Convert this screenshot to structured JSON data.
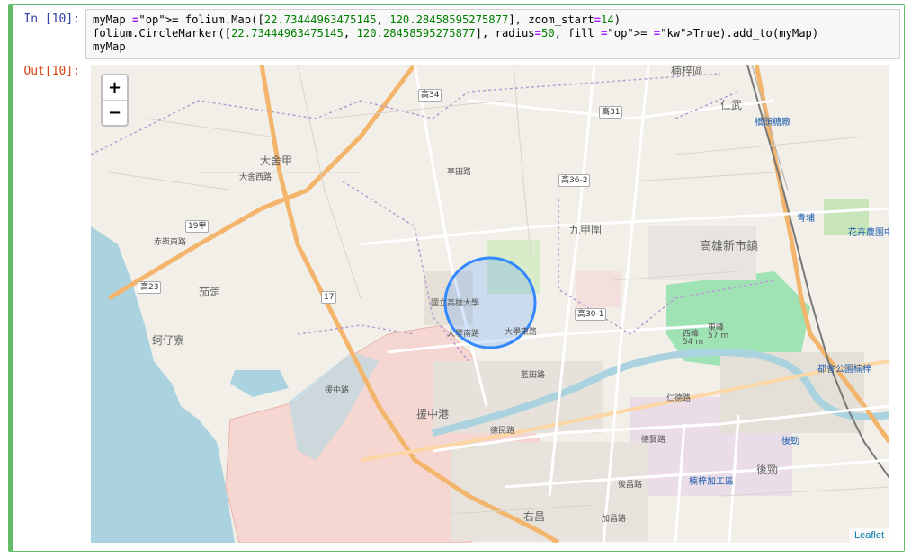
{
  "cell": {
    "in_prompt": "In [10]:",
    "out_prompt": "Out[10]:",
    "code_lines": [
      "myMap = folium.Map([22.73444963475145, 120.28458595275877], zoom_start=14)",
      "folium.CircleMarker([22.73444963475145, 120.28458595275877], radius=50, fill = True).add_to(myMap)",
      "myMap"
    ]
  },
  "map": {
    "zoom_in": "+",
    "zoom_out": "−",
    "attribution": "Leaflet",
    "marker_color": "#3388ff",
    "places": {
      "nanzi": "楠梓區",
      "renwu": "仁武",
      "dashe": "大舍甲",
      "jiujia": "九甲圍",
      "gaoxiong_new": "高雄新市鎮",
      "zhiding": "茄萣",
      "heziliao": "蚵仔寮",
      "houjin": "後勁",
      "youchang": "右昌",
      "yuanzhonggang": "援中港",
      "university": "國立高雄大學",
      "xifeng": "西峰",
      "xifeng_h": "54 m",
      "dongfeng": "東峰",
      "dongfeng_h": "57 m",
      "nanzi_station": "楠梓",
      "metro": "都會公園",
      "houjin2": "後勁",
      "processing": "楠梓加工區",
      "qingpu": "青埔",
      "flower": "花卉農園中心",
      "ciaotou_station": "橋頭糖廠"
    },
    "roads": {
      "r1": "高34",
      "r2": "高31",
      "r3": "高36-2",
      "r4": "高30-1",
      "r5": "19甲",
      "r6": "高23",
      "r7": "17",
      "s1": "大學南路",
      "s2": "大學東路",
      "s3": "藍田路",
      "s4": "德民路",
      "s5": "援中路",
      "s6": "後昌路",
      "s7": "加昌路",
      "s8": "享田路",
      "s9": "大舍西路",
      "s10": "赤崁東路",
      "s11": "仁德路",
      "s12": "德賢路"
    }
  }
}
